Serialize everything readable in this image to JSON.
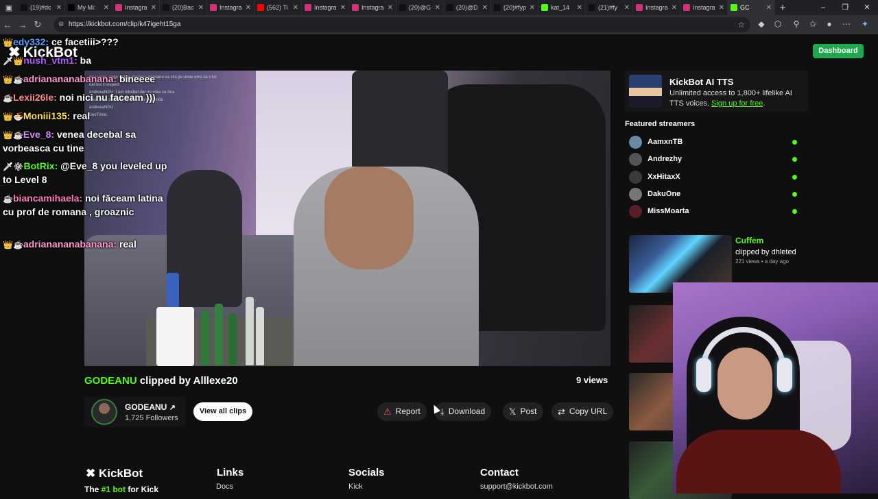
{
  "browser": {
    "tabs": [
      {
        "label": "(19)#dc",
        "color": "#111111"
      },
      {
        "label": "My Mi:",
        "color": "#000000"
      },
      {
        "label": "Instagra",
        "color": "#d6307a"
      },
      {
        "label": "(20)Bac",
        "color": "#111111"
      },
      {
        "label": "Instagra",
        "color": "#d6307a"
      },
      {
        "label": "(562) Ti",
        "color": "#ff0000"
      },
      {
        "label": "Instagra",
        "color": "#d6307a"
      },
      {
        "label": "Instagra",
        "color": "#d6307a"
      },
      {
        "label": "(20)@G",
        "color": "#111111"
      },
      {
        "label": "(20)@D",
        "color": "#111111"
      },
      {
        "label": "(20)#fyp",
        "color": "#111111"
      },
      {
        "label": "kat_14",
        "color": "#53fc18"
      },
      {
        "label": "(21)#fy",
        "color": "#111111"
      },
      {
        "label": "Instagra",
        "color": "#d6307a"
      },
      {
        "label": "Instagra",
        "color": "#d6307a"
      },
      {
        "label": "GC",
        "color": "#53fc18"
      }
    ],
    "url": "https://kickbot.com/clip/k47igeht15ga",
    "new_tab": "+"
  },
  "header": {
    "logo": "KickBot",
    "dashboard_label": "Dashboard"
  },
  "chat": [
    {
      "badge": "👑",
      "user": "edy332:",
      "color": "#5aa2ff",
      "text": "ce facetiii>???"
    },
    {
      "badge": "🗡👑",
      "user": "nush_vtm1:",
      "color": "#b05cff",
      "text": "ba"
    },
    {
      "badge": "👑☕",
      "user": "adrianananabanana:",
      "color": "#ff9ad0",
      "text": "bineeee"
    },
    {
      "badge": "☕",
      "user": "Lexii26le:",
      "color": "#ff8a8a",
      "text": "noi nici nu faceam )))"
    },
    {
      "badge": "👑🍜",
      "user": "Moniii135:",
      "color": "#ffe04d",
      "text": "real"
    },
    {
      "badge": "👑☕",
      "user": "Eve_8:",
      "color": "#d88cff",
      "text": "venea decebal sa vorbeasca cu tine"
    },
    {
      "badge": "🗡❇",
      "user": "BotRix:",
      "color": "#53fc18",
      "text": "@Eve_8 you leveled up to Level 8"
    },
    {
      "badge": "☕",
      "user": "biancamihaela:",
      "color": "#ff7ab8",
      "text": "noi făceam latina cu prof de romana , groaznic"
    },
    {
      "badge": "👑☕",
      "user": "adrianananabanana:",
      "color": "#ff9ad0",
      "text": "real"
    }
  ],
  "chat_mini": [
    "BeeTrixie: unde isi tine frigideru godeanu sa stiu pe unde intru sa il fur",
    "daf bot il respect",
    "andreeaNGU: I am intrebat dar nu vrea sa zica",
    "BeeTrixie: mai devr n a vrut sa raspunda",
    "andreeaNGU:",
    "BeeTrixie:"
  ],
  "clip": {
    "channel": "GODEANU",
    "clipped_by": "clipped by Alllexe20",
    "views": "9 views"
  },
  "streamer": {
    "name": "GODEANU",
    "external_icon": "↗",
    "followers": "1,725 Followers",
    "view_all": "View all clips"
  },
  "actions": {
    "report": "Report",
    "download": "Download",
    "post": "Post",
    "copy_url": "Copy URL"
  },
  "sidebar": {
    "tts_title": "KickBot AI TTS",
    "tts_desc": "Unlimited access to 1,800+ lifelike AI TTS voices.",
    "tts_link": "Sign up for free",
    "tts_end": ".",
    "featured_title": "Featured streamers",
    "featured": [
      {
        "name": "AamxnTB",
        "color": "#6a8aa0"
      },
      {
        "name": "Andrezhy",
        "color": "#555555"
      },
      {
        "name": "XxHitaxX",
        "color": "#3a3a3a"
      },
      {
        "name": "DakuOne",
        "color": "#777777"
      },
      {
        "name": "MissMoarta",
        "color": "#5a1e2a"
      }
    ],
    "related": {
      "title": "Cuffem",
      "by": "clipped by dhleted",
      "meta": "221 views • a day ago"
    }
  },
  "footer": {
    "logo": "KickBot",
    "tag_pre": "The ",
    "tag_link": "#1 bot",
    "tag_post": " for Kick",
    "links_h": "Links",
    "links_item": "Docs",
    "socials_h": "Socials",
    "socials_item": "Kick",
    "contact_h": "Contact",
    "contact_item": "support@kickbot.com"
  },
  "colors": {
    "accent": "#53fc18",
    "dashboard": "#1fa84d"
  }
}
